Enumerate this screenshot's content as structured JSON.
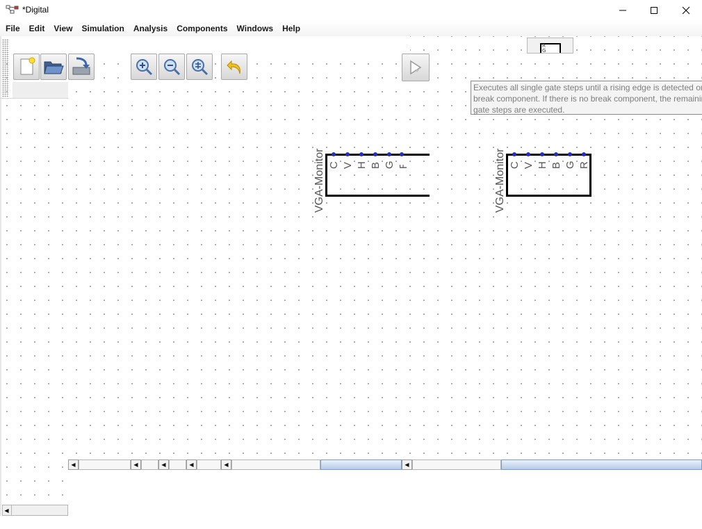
{
  "window": {
    "title": "*Digital",
    "controls": {
      "minimize": "minimize-icon",
      "maximize": "maximize-icon",
      "close": "close-icon"
    }
  },
  "menubar": {
    "items": [
      "File",
      "Edit",
      "View",
      "Simulation",
      "Analysis",
      "Components",
      "Windows",
      "Help"
    ]
  },
  "toolbar": {
    "buttons": [
      {
        "name": "new-button",
        "icon": "new-file-icon"
      },
      {
        "name": "open-button",
        "icon": "folder-open-icon"
      },
      {
        "name": "save-button",
        "icon": "save-icon"
      },
      {
        "name": "zoom-in-button",
        "icon": "zoom-in-icon"
      },
      {
        "name": "zoom-out-button",
        "icon": "zoom-out-icon"
      },
      {
        "name": "zoom-fit-button",
        "icon": "zoom-fit-icon"
      },
      {
        "name": "undo-button",
        "icon": "undo-icon"
      },
      {
        "name": "run-to-break-button",
        "icon": "step-icon"
      }
    ]
  },
  "tooltip": {
    "line1": "Executes all single gate steps until a rising edge is detected on a",
    "line2": "break component. If there is no break component, the remaining single",
    "line3": "gate steps are executed."
  },
  "preview": {
    "pin_text_1": "R",
    "pin_text_2": "G"
  },
  "circuit": {
    "components": [
      {
        "label": "VGA-Monitor",
        "pins": [
          "C",
          "V",
          "H",
          "B",
          "G",
          "R"
        ]
      },
      {
        "label": "VGA-Monitor",
        "pins": [
          "C",
          "V",
          "H",
          "B",
          "G",
          "R"
        ]
      }
    ]
  },
  "colors": {
    "pin": "#1d2fd0",
    "scroll_thumb": "#b7cce8",
    "tooltip_text": "#7d7d7d"
  }
}
